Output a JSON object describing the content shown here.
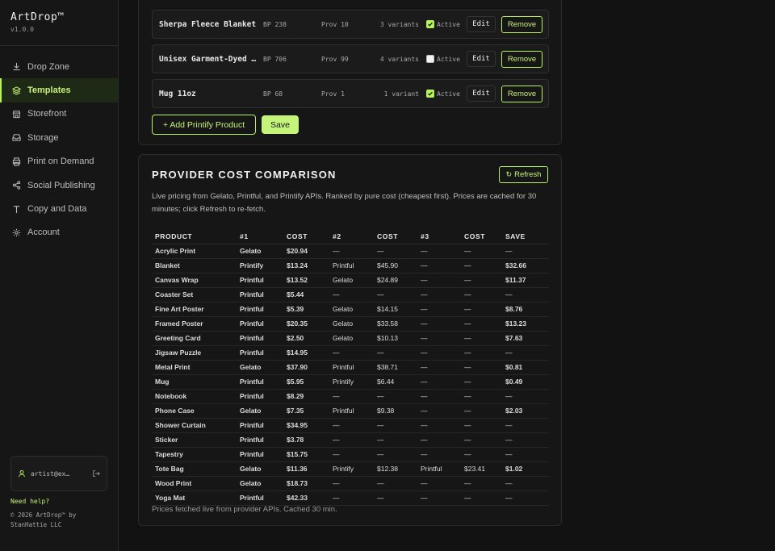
{
  "app": {
    "name": "ArtDrop™",
    "version": "v1.0.0"
  },
  "sidebar": {
    "items": [
      {
        "label": "Drop Zone",
        "icon": "download-icon",
        "active": false
      },
      {
        "label": "Templates",
        "icon": "layers-icon",
        "active": true
      },
      {
        "label": "Storefront",
        "icon": "store-icon",
        "active": false
      },
      {
        "label": "Storage",
        "icon": "storage-icon",
        "active": false
      },
      {
        "label": "Print on Demand",
        "icon": "printer-icon",
        "active": false
      },
      {
        "label": "Social Publishing",
        "icon": "share-icon",
        "active": false
      },
      {
        "label": "Copy and Data",
        "icon": "text-icon",
        "active": false
      },
      {
        "label": "Account",
        "icon": "gear-icon",
        "active": false
      }
    ],
    "user_email": "artist@ex…",
    "help": "Need help?",
    "copyright": "© 2026 ArtDrop™ by StanHattie LLC"
  },
  "templates": {
    "rows": [
      {
        "name": "Sherpa Fleece Blanket",
        "bp": "BP 238",
        "prov": "Prov 10",
        "variants": "3 variants",
        "active_label": "Active",
        "active": true,
        "edit": "Edit",
        "remove": "Remove"
      },
      {
        "name": "Unisex Garment-Dyed …",
        "bp": "BP 706",
        "prov": "Prov 99",
        "variants": "4 variants",
        "active_label": "Active",
        "active": false,
        "edit": "Edit",
        "remove": "Remove"
      },
      {
        "name": "Mug 11oz",
        "bp": "BP 68",
        "prov": "Prov 1",
        "variants": "1 variant",
        "active_label": "Active",
        "active": true,
        "edit": "Edit",
        "remove": "Remove"
      }
    ],
    "add_label": "+ Add Printify Product",
    "save_label": "Save"
  },
  "comparison": {
    "title": "PROVIDER COST COMPARISON",
    "refresh_label": "Refresh",
    "description": "Live pricing from Gelato, Printful, and Printify APIs. Ranked by pure cost (cheapest first). Prices are cached for 30 minutes; click Refresh to re-fetch.",
    "headers": [
      "PRODUCT",
      "#1",
      "COST",
      "#2",
      "COST",
      "#3",
      "COST",
      "SAVE"
    ],
    "rows": [
      [
        "Acrylic Print",
        "Gelato",
        "$20.94",
        "—",
        "—",
        "—",
        "—",
        "—"
      ],
      [
        "Blanket",
        "Printify",
        "$13.24",
        "Printful",
        "$45.90",
        "—",
        "—",
        "$32.66"
      ],
      [
        "Canvas Wrap",
        "Printful",
        "$13.52",
        "Gelato",
        "$24.89",
        "—",
        "—",
        "$11.37"
      ],
      [
        "Coaster Set",
        "Printful",
        "$5.44",
        "—",
        "—",
        "—",
        "—",
        "—"
      ],
      [
        "Fine Art Poster",
        "Printful",
        "$5.39",
        "Gelato",
        "$14.15",
        "—",
        "—",
        "$8.76"
      ],
      [
        "Framed Poster",
        "Printful",
        "$20.35",
        "Gelato",
        "$33.58",
        "—",
        "—",
        "$13.23"
      ],
      [
        "Greeting Card",
        "Printful",
        "$2.50",
        "Gelato",
        "$10.13",
        "—",
        "—",
        "$7.63"
      ],
      [
        "Jigsaw Puzzle",
        "Printful",
        "$14.95",
        "—",
        "—",
        "—",
        "—",
        "—"
      ],
      [
        "Metal Print",
        "Gelato",
        "$37.90",
        "Printful",
        "$38.71",
        "—",
        "—",
        "$0.81"
      ],
      [
        "Mug",
        "Printful",
        "$5.95",
        "Printify",
        "$6.44",
        "—",
        "—",
        "$0.49"
      ],
      [
        "Notebook",
        "Printful",
        "$8.29",
        "—",
        "—",
        "—",
        "—",
        "—"
      ],
      [
        "Phone Case",
        "Gelato",
        "$7.35",
        "Printful",
        "$9.38",
        "—",
        "—",
        "$2.03"
      ],
      [
        "Shower Curtain",
        "Printful",
        "$34.95",
        "—",
        "—",
        "—",
        "—",
        "—"
      ],
      [
        "Sticker",
        "Printful",
        "$3.78",
        "—",
        "—",
        "—",
        "—",
        "—"
      ],
      [
        "Tapestry",
        "Printful",
        "$15.75",
        "—",
        "—",
        "—",
        "—",
        "—"
      ],
      [
        "Tote Bag",
        "Gelato",
        "$11.36",
        "Printify",
        "$12.38",
        "Printful",
        "$23.41",
        "$1.02"
      ],
      [
        "Wood Print",
        "Gelato",
        "$18.73",
        "—",
        "—",
        "—",
        "—",
        "—"
      ],
      [
        "Yoga Mat",
        "Printful",
        "$42.33",
        "—",
        "—",
        "—",
        "—",
        "—"
      ]
    ],
    "footer": "Prices fetched live from provider APIs. Cached 30 min."
  },
  "colors": {
    "accent": "#b6f25a",
    "background": "#121212",
    "panel": "#161616"
  }
}
